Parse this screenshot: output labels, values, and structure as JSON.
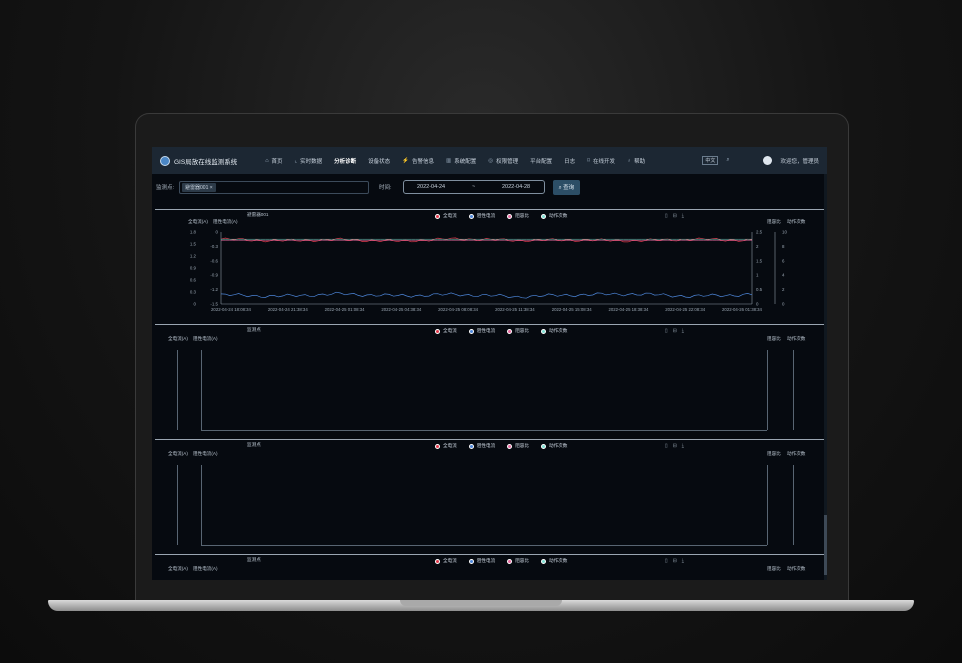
{
  "app": {
    "title": "GIS局放在线监测系统"
  },
  "nav": [
    {
      "icon": "home-icon",
      "glyph": "⌂",
      "label": "首页",
      "active": false
    },
    {
      "icon": "chart-icon",
      "glyph": "⌞",
      "label": "实时数据",
      "active": false
    },
    {
      "icon": "",
      "glyph": "",
      "label": "分析诊断",
      "active": true
    },
    {
      "icon": "",
      "glyph": "",
      "label": "设备状态",
      "active": false
    },
    {
      "icon": "alarm-icon",
      "glyph": "⚡",
      "label": "告警信息",
      "active": false
    },
    {
      "icon": "settings-icon",
      "glyph": "▥",
      "label": "系统配置",
      "active": false
    },
    {
      "icon": "permission-icon",
      "glyph": "◎",
      "label": "权限管理",
      "active": false
    },
    {
      "icon": "",
      "glyph": "",
      "label": "平台配置",
      "active": false
    },
    {
      "icon": "",
      "glyph": "",
      "label": "日志",
      "active": false
    },
    {
      "icon": "dev-icon",
      "glyph": "⌑",
      "label": "在线开发",
      "active": false
    },
    {
      "icon": "help-icon",
      "glyph": "♁",
      "label": "帮助",
      "active": false
    }
  ],
  "header_right": {
    "lang": "中文",
    "welcome": "欢迎您，管理员"
  },
  "filter": {
    "monitor_label": "监测点:",
    "monitor_tag": "避雷器001",
    "time_label": "时间:",
    "date_start": "2022-04-24",
    "date_sep": "~",
    "date_end": "2022-04-28",
    "query_label": "查询"
  },
  "legend": [
    {
      "label": "全电流",
      "color": "#e0394b"
    },
    {
      "label": "阻性电流",
      "color": "#4d86d9"
    },
    {
      "label": "阻容比",
      "color": "#e86aa0"
    },
    {
      "label": "动作次数",
      "color": "#7fe0d2"
    }
  ],
  "axes": {
    "left1": "全电流(A)",
    "left2": "阻性电流(A)",
    "right1": "阻容比",
    "right2": "动作次数"
  },
  "panels": [
    {
      "title": "避雷器001"
    },
    {
      "title": "监测点"
    },
    {
      "title": "监测点"
    },
    {
      "title": "监测点"
    }
  ],
  "chart_data": {
    "type": "line",
    "title": "避雷器001",
    "x": [
      "2022-04-24 18:08:34",
      "2022-04-24 21:38:34",
      "2022-04-25 01:08:34",
      "2022-04-25 04:38:34",
      "2022-04-25 08:08:34",
      "2022-04-25 11:38:34",
      "2022-04-25 15:08:34",
      "2022-04-25 18:38:34",
      "2022-04-25 22:08:34",
      "2022-04-26 01:38:34"
    ],
    "y_left_ticks": [
      "1.8",
      "1.5",
      "1.2",
      "0.9",
      "0.6",
      "0.3",
      "0"
    ],
    "y_left2_ticks": [
      "0",
      "-0.3",
      "-0.6",
      "-0.9",
      "-1.2",
      "-1.5"
    ],
    "y_right1_ticks": [
      "2.5",
      "2",
      "1.5",
      "1",
      "0.5",
      "0"
    ],
    "y_right2_ticks": [
      "10",
      "8",
      "6",
      "4",
      "2",
      "0"
    ],
    "series": [
      {
        "name": "全电流",
        "values": [
          1.62,
          1.58,
          1.61,
          1.57,
          1.63,
          1.59,
          1.6,
          1.58,
          1.62,
          1.59
        ]
      },
      {
        "name": "阻性电流",
        "values": [
          -1.31,
          -1.34,
          -1.29,
          -1.33,
          -1.3,
          -1.35,
          -1.31,
          -1.29,
          -1.34,
          -1.3
        ]
      },
      {
        "name": "阻容比",
        "values": [
          2.2,
          2.2,
          2.2,
          2.2,
          2.2,
          2.2,
          2.2,
          2.2,
          2.2,
          2.2
        ]
      },
      {
        "name": "动作次数",
        "values": [
          9,
          9,
          9,
          9,
          9,
          9,
          9,
          9,
          9,
          9
        ]
      }
    ]
  }
}
